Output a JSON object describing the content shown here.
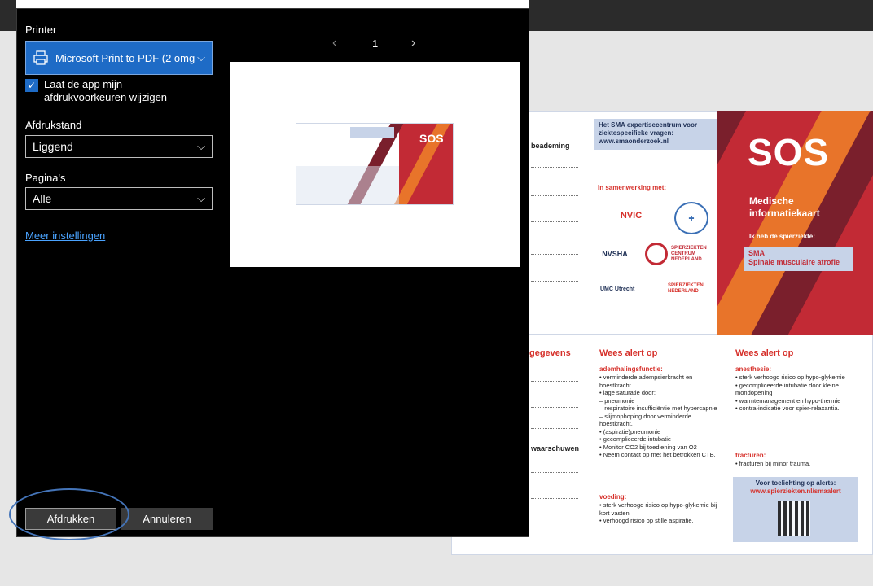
{
  "dialog": {
    "printer_label": "Printer",
    "printer_value": "Microsoft Print to PDF (2 omg",
    "checkbox_label": "Laat de app mijn afdrukvoorkeuren wijzigen",
    "checkbox_checked": true,
    "orientation_label": "Afdrukstand",
    "orientation_value": "Liggend",
    "pages_label": "Pagina's",
    "pages_value": "Alle",
    "more_settings": "Meer instellingen",
    "page_number": "1",
    "print_button": "Afdrukken",
    "cancel_button": "Annuleren"
  },
  "card_top": {
    "ventilation_label": "beademing",
    "info_box": "Het SMA expertisecentrum voor ziektespecifieke vragen: www.smaonderzoek.nl",
    "partnership": "In samenwerking met:",
    "logo_nvic": "NVIC",
    "logo_nvsha": "NVSHA",
    "logo_spierziekten_centrum": "SPIERZIEKTEN CENTRUM NEDERLAND",
    "logo_umc": "UMC Utrecht",
    "logo_spierziekten_nl": "SPIERZIEKTEN NEDERLAND",
    "sos": "SOS",
    "medical_title": "Medische informatiekaart",
    "disease_intro": "Ik heb de spierziekte:",
    "sma_abbr": "SMA",
    "sma_full": "Spinale musculaire atrofie"
  },
  "card_bottom": {
    "gegevens": "gegevens",
    "waarschuwen": "waarschuwen",
    "alert_title_1": "Wees alert op",
    "alert_title_2": "Wees alert op",
    "col1_heading": "ademhalingsfunctie:",
    "col1_text": "• verminderde adempsierkracht en hoestkracht\n• lage saturatie door:\n  – pneumonie\n  – respiratoire insufficiëntie met hypercapnie\n  – slijmophoping door verminderde hoestkracht.\n• (aspiratie)pneumonie\n• gecompliceerde intubatie\n• Monitor CO2 bij toediening van O2\n• Neem contact op met het betrokken CTB.",
    "col1_voeding": "voeding:",
    "col1_voeding_text": "• sterk verhoogd risico op hypo-glykemie bij kort vasten\n• verhoogd risico op stille aspiratie.",
    "col2_heading": "anesthesie:",
    "col2_text": "• sterk verhoogd risico op hypo-glykemie\n• gecompliceerde intubatie door kleine mondopening\n• warmtemanagement en hypo-thermie\n• contra-indicatie voor spier-relaxantia.",
    "col2_fracturen": "fracturen:",
    "col2_fracturen_text": "• fracturen bij minor trauma.",
    "alert_info": "Voor toelichting op alerts:",
    "alert_url": "www.spierziekten.nl/smaalert"
  },
  "colors": {
    "accent": "#1e6bc6",
    "sos_red": "#c22a35",
    "stripe_orange": "#e8742a",
    "stripe_dark": "#7a1f2c"
  }
}
